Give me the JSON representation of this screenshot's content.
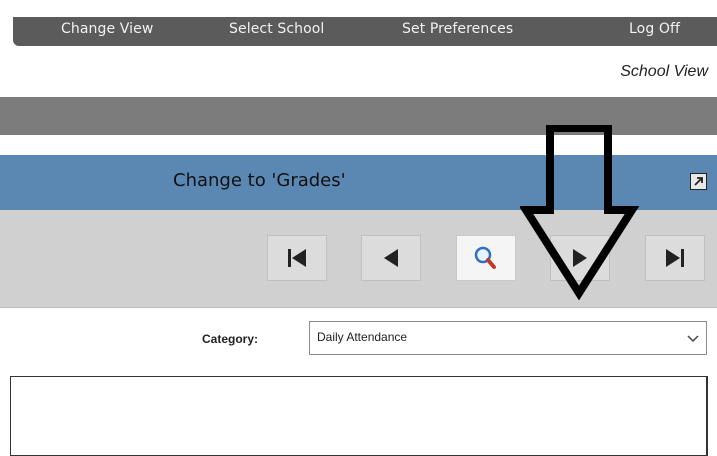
{
  "topnav": {
    "change_view": "Change View",
    "select_school": "Select School",
    "set_preferences": "Set Preferences",
    "log_off": "Log Off"
  },
  "header": {
    "school_view": "School View"
  },
  "panel": {
    "title": "Change to 'Grades'"
  },
  "navigation": {
    "buttons": [
      "first-icon",
      "previous-icon",
      "search-icon",
      "next-icon",
      "last-icon"
    ]
  },
  "filters": {
    "category_label": "Category:",
    "category_value": "Daily Attendance"
  },
  "colors": {
    "topbar": "#5b5b5b",
    "title_bar": "#5b88b3",
    "dark_band": "#7c7c7c",
    "nav_bar": "#d0d0d0"
  }
}
